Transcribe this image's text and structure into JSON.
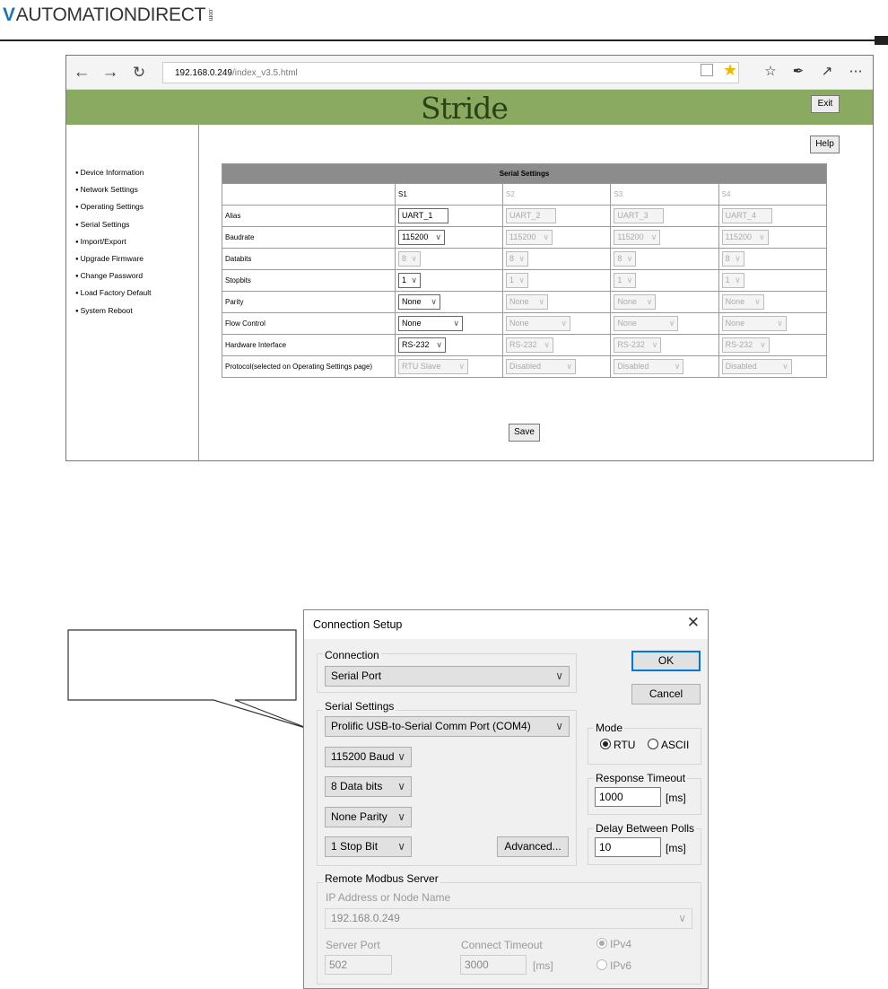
{
  "logo": {
    "brand": "AUTOMATIONDIRECT",
    "suffix": ".com"
  },
  "browser": {
    "url_host": "192.168.0.249",
    "url_path": "/index_v3.5.html",
    "icons": [
      "back-arrow-icon",
      "forward-arrow-icon",
      "refresh-icon",
      "reading-view-icon",
      "favorite-star-icon",
      "favorites-list-icon",
      "notes-pen-icon",
      "share-icon",
      "more-icon"
    ]
  },
  "app": {
    "brand": "Stride",
    "exit_label": "Exit",
    "help_label": "Help",
    "save_label": "Save",
    "sidebar": [
      "Device Information",
      "Network Settings",
      "Operating Settings",
      "Serial Settings",
      "Import/Export",
      "Upgrade Firmware",
      "Change Password",
      "Load Factory Default",
      "System Reboot"
    ],
    "table": {
      "title": "Serial Settings",
      "columns": [
        "S1",
        "S2",
        "S3",
        "S4"
      ],
      "rows": [
        {
          "label": "Alias",
          "values": [
            "UART_1",
            "UART_2",
            "UART_3",
            "UART_4"
          ]
        },
        {
          "label": "Baudrate",
          "values": [
            "115200",
            "115200",
            "115200",
            "115200"
          ]
        },
        {
          "label": "Databits",
          "values": [
            "8",
            "8",
            "8",
            "8"
          ]
        },
        {
          "label": "Stopbits",
          "values": [
            "1",
            "1",
            "1",
            "1"
          ]
        },
        {
          "label": "Parity",
          "values": [
            "None",
            "None",
            "None",
            "None"
          ]
        },
        {
          "label": "Flow Control",
          "values": [
            "None",
            "None",
            "None",
            "None"
          ]
        },
        {
          "label": "Hardware Interface",
          "values": [
            "RS-232",
            "RS-232",
            "RS-232",
            "RS-232"
          ]
        },
        {
          "label": "Protocol(selected on Operating Settings page)",
          "values": [
            "RTU Slave",
            "Disabled",
            "Disabled",
            "Disabled"
          ]
        }
      ]
    }
  },
  "dialog": {
    "title": "Connection Setup",
    "connection_group": "Connection",
    "connection_value": "Serial Port",
    "serial_group": "Serial Settings",
    "port_value": "Prolific USB-to-Serial Comm Port (COM4)",
    "baud_value": "115200 Baud",
    "databits_value": "8 Data bits",
    "parity_value": "None Parity",
    "stopbit_value": "1 Stop Bit",
    "advanced_label": "Advanced...",
    "ok_label": "OK",
    "cancel_label": "Cancel",
    "mode_group": "Mode",
    "mode_rtu": "RTU",
    "mode_ascii": "ASCII",
    "response_group": "Response Timeout",
    "response_value": "1000",
    "ms_unit": "[ms]",
    "delay_group": "Delay Between Polls",
    "delay_value": "10",
    "remote_group": "Remote Modbus Server",
    "ip_label": "IP Address or Node Name",
    "ip_value": "192.168.0.249",
    "server_port_label": "Server Port",
    "server_port_value": "502",
    "connect_timeout_label": "Connect Timeout",
    "connect_timeout_value": "3000",
    "ipv4_label": "IPv4",
    "ipv6_label": "IPv6"
  }
}
